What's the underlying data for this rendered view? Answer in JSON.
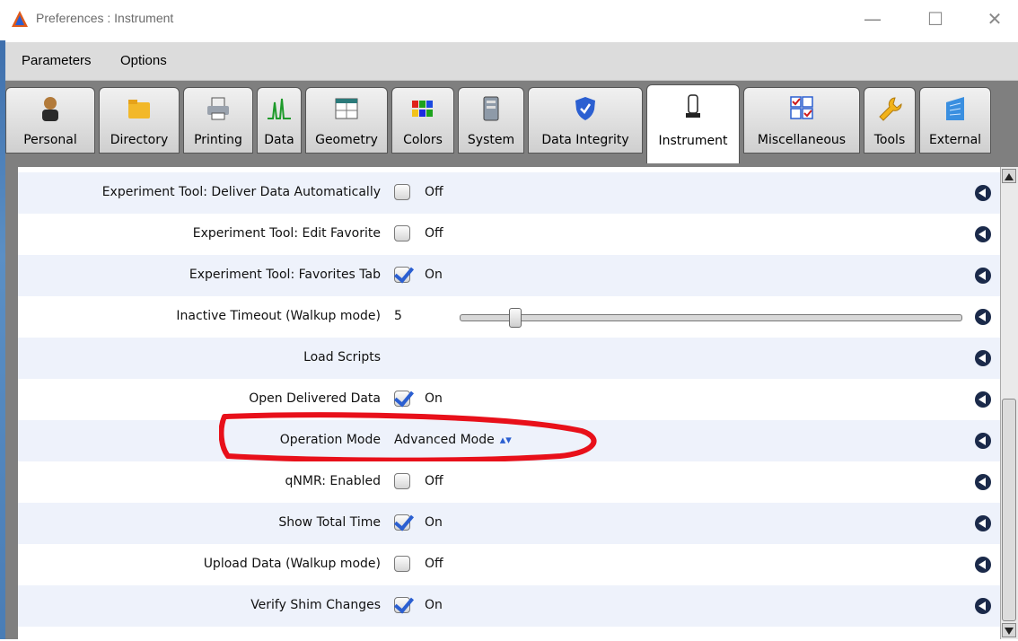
{
  "window": {
    "title": "Preferences : Instrument",
    "controls": {
      "minimize": "—",
      "maximize": "☐",
      "close": "✕"
    }
  },
  "menu": [
    "Parameters",
    "Options"
  ],
  "tabs": [
    {
      "label": "Personal",
      "icon": "person-icon"
    },
    {
      "label": "Directory",
      "icon": "folder-icon"
    },
    {
      "label": "Printing",
      "icon": "printer-icon"
    },
    {
      "label": "Data",
      "icon": "spectrum-icon"
    },
    {
      "label": "Geometry",
      "icon": "window-icon"
    },
    {
      "label": "Colors",
      "icon": "color-bars-icon"
    },
    {
      "label": "System",
      "icon": "server-icon"
    },
    {
      "label": "Data Integrity",
      "icon": "shield-icon"
    },
    {
      "label": "Instrument",
      "icon": "magnet-icon",
      "active": true
    },
    {
      "label": "Miscellaneous",
      "icon": "checklist-icon"
    },
    {
      "label": "Tools",
      "icon": "wrench-icon"
    },
    {
      "label": "External",
      "icon": "building-icon"
    }
  ],
  "rows": [
    {
      "label": "Experiment Tool: Deliver Data Automatically",
      "type": "checkbox",
      "checked": false,
      "value": "Off"
    },
    {
      "label": "Experiment Tool: Edit Favorite",
      "type": "checkbox",
      "checked": false,
      "value": "Off"
    },
    {
      "label": "Experiment Tool: Favorites Tab",
      "type": "checkbox",
      "checked": true,
      "value": "On"
    },
    {
      "label": "Inactive Timeout (Walkup mode)",
      "type": "slider",
      "value": "5",
      "slider_fraction": 0.1
    },
    {
      "label": "Load Scripts",
      "type": "none",
      "value": ""
    },
    {
      "label": "Open Delivered Data",
      "type": "checkbox",
      "checked": true,
      "value": "On"
    },
    {
      "label": "Operation Mode",
      "type": "select",
      "value": "Advanced Mode"
    },
    {
      "label": "qNMR: Enabled",
      "type": "checkbox",
      "checked": false,
      "value": "Off"
    },
    {
      "label": "Show Total Time",
      "type": "checkbox",
      "checked": true,
      "value": "On"
    },
    {
      "label": "Upload Data (Walkup mode)",
      "type": "checkbox",
      "checked": false,
      "value": "Off"
    },
    {
      "label": "Verify Shim Changes",
      "type": "checkbox",
      "checked": true,
      "value": "On"
    }
  ],
  "colors": {
    "accent": "#2b5fd1",
    "highlight": "#e8101a",
    "row_alt": "#eef2fb"
  },
  "select_arrow": "▴▾"
}
